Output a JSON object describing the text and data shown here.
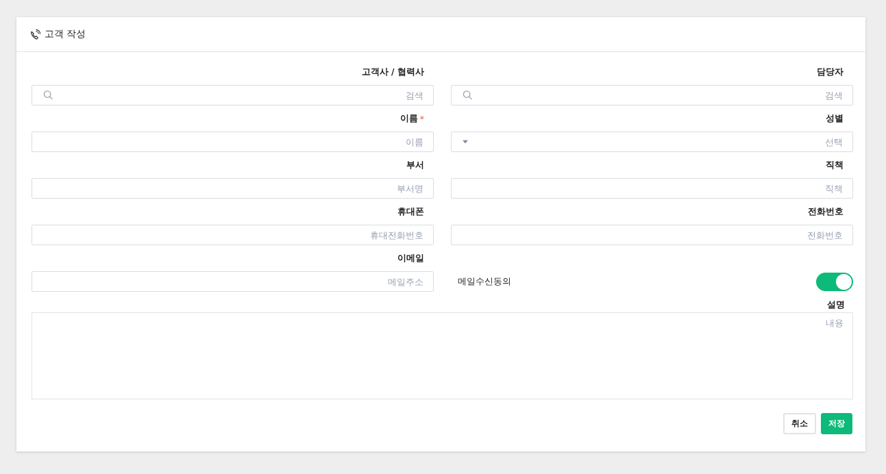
{
  "title": "고객 작성",
  "fields": [
    {
      "kind": "search",
      "label": "고객사 / 협력사",
      "placeholder": "검색"
    },
    {
      "kind": "search",
      "label": "담당자",
      "placeholder": "검색"
    },
    {
      "kind": "text",
      "label": "이름",
      "required_mark": "*",
      "placeholder": "이름"
    },
    {
      "kind": "select",
      "label": "성별",
      "placeholder": "선택"
    },
    {
      "kind": "text",
      "label": "부서",
      "placeholder": "부서명"
    },
    {
      "kind": "text",
      "label": "직책",
      "placeholder": "직책"
    },
    {
      "kind": "text",
      "label": "휴대폰",
      "placeholder": "휴대전화번호"
    },
    {
      "kind": "text",
      "label": "전화번호",
      "placeholder": "전화번호"
    },
    {
      "kind": "text",
      "label": "이메일",
      "placeholder": "메일주소"
    },
    {
      "kind": "toggle",
      "label": "메일수신동의",
      "on": true
    }
  ],
  "description": {
    "label": "설명",
    "placeholder": "내용"
  },
  "buttons": [
    {
      "kind": "secondary",
      "label": "취소"
    },
    {
      "kind": "primary",
      "label": "저장"
    }
  ]
}
